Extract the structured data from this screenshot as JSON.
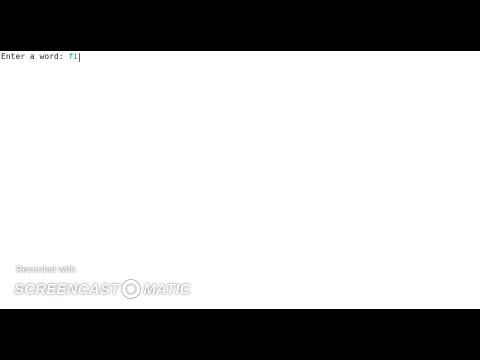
{
  "console": {
    "prompt": "Enter a word: ",
    "input": "fi"
  },
  "watermark": {
    "recorded_with": "Recorded with",
    "brand_left": "SCREENCAST",
    "brand_right": "MATIC",
    "logo_icon": "screencast-o-matic-logo-icon"
  },
  "colors": {
    "letterbox": "#000000",
    "console_background": "#ffffff",
    "prompt_text": "#2b2b2b",
    "input_text": "#1a9a3a"
  }
}
